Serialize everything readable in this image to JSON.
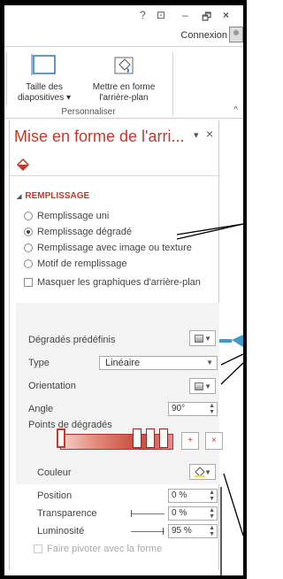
{
  "titlebar": {
    "help": "?",
    "ribbon_display": "⊡",
    "minimize": "–",
    "restore": "🗗",
    "close": "×",
    "account": "Connexion"
  },
  "ribbon": {
    "buttons": [
      {
        "label_line1": "Taille des",
        "label_line2": "diapositives ▾"
      },
      {
        "label_line1": "Mettre en forme",
        "label_line2": "l'arrière-plan"
      }
    ],
    "group": "Personnaliser",
    "collapse": "^"
  },
  "pane": {
    "title": "Mise en forme de l'arri...",
    "menu": "▾",
    "close": "×",
    "section": "REMPLISSAGE",
    "section_caret": "◢",
    "fill_options": [
      {
        "label": "Remplissage uni",
        "selected": false
      },
      {
        "label": "Remplissage dégradé",
        "selected": true
      },
      {
        "label": "Remplissage avec image ou texture",
        "selected": false
      },
      {
        "label": "Motif de remplissage",
        "selected": false
      }
    ],
    "hide_graphics": "Masquer les graphiques d'arrière-plan",
    "preset_label": "Dégradés prédéfinis",
    "type_label": "Type",
    "type_value": "Linéaire",
    "orientation_label": "Orientation",
    "angle_label": "Angle",
    "angle_value": "90°",
    "stops_label": "Points de dégradés",
    "color_label": "Couleur",
    "position_label": "Position",
    "position_value": "0 %",
    "transparency_label": "Transparence",
    "transparency_value": "0 %",
    "brightness_label": "Luminosité",
    "brightness_value": "95 %",
    "rotate_label": "Faire pivoter avec la forme",
    "brightness_level_percent": 95,
    "transparency_level_percent": 0
  },
  "colors": {
    "accent": "#c0392b",
    "callout_arrow": "#3a9bd0"
  }
}
